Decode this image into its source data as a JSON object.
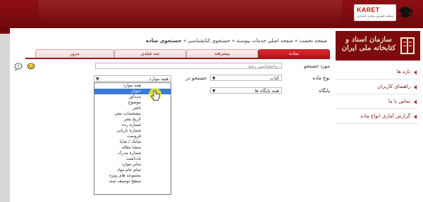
{
  "karet": {
    "name": "KARET",
    "tagline": "سامانه آموزش مجازی کتابداری"
  },
  "logo_text": "سازمان اسناد و کتابخانه ملی ایران",
  "sidebar": {
    "items": [
      {
        "label": "تازه ها"
      },
      {
        "label": "راهنمای کاربران"
      },
      {
        "label": "تماس با ما"
      },
      {
        "label": "گزارش آماری انواع ماده"
      }
    ]
  },
  "breadcrumb": {
    "prefix": "صفحه نخست » صفحه اصلی خدمات پیوسته » جستجوی کتابشناسی » ",
    "current": "جستجوی ساده"
  },
  "tabs": [
    {
      "label": "ساده",
      "active": true
    },
    {
      "label": "پیشرفته",
      "active": false
    },
    {
      "label": "چند فیلدی",
      "active": false
    },
    {
      "label": "مرور",
      "active": false
    }
  ],
  "form": {
    "search_term_label": "مورد جستجو",
    "search_term_value": "روانشناسی رشد",
    "material_type_label": "نوع ماده",
    "material_type_value": "کتاب",
    "search_in_label": "جستجو در",
    "search_in_value": "همه موارد",
    "database_label": "پایگاه",
    "database_value": "همه پایگاه ها"
  },
  "dropdown_options": [
    {
      "label": "همه موارد",
      "highlighted": false
    },
    {
      "label": "عنوان",
      "highlighted": true
    },
    {
      "label": "پدیدآور",
      "highlighted": false
    },
    {
      "label": "موضوع",
      "highlighted": false
    },
    {
      "label": "ناشر",
      "highlighted": false
    },
    {
      "label": "مشخصات نشر",
      "highlighted": false
    },
    {
      "label": "تاریخ نشر",
      "highlighted": false
    },
    {
      "label": "شماره رده",
      "highlighted": false
    },
    {
      "label": "شماره بازیابی",
      "highlighted": false
    },
    {
      "label": "فروست",
      "highlighted": false
    },
    {
      "label": "شابک / شاپا",
      "highlighted": false
    },
    {
      "label": "منشا مقاله",
      "highlighted": false
    },
    {
      "label": "شماره مدرک",
      "highlighted": false
    },
    {
      "label": "یادداشت",
      "highlighted": false
    },
    {
      "label": "سایر موارد",
      "highlighted": false
    },
    {
      "label": "تمام عام مواد",
      "highlighted": false
    },
    {
      "label": "مجموعه های ویژه",
      "highlighted": false
    },
    {
      "label": "سطح توصیف سند",
      "highlighted": false
    }
  ],
  "colors": {
    "brand": "#8a1016",
    "tab_active": "#c4161c",
    "highlight": "#3a79d6"
  }
}
